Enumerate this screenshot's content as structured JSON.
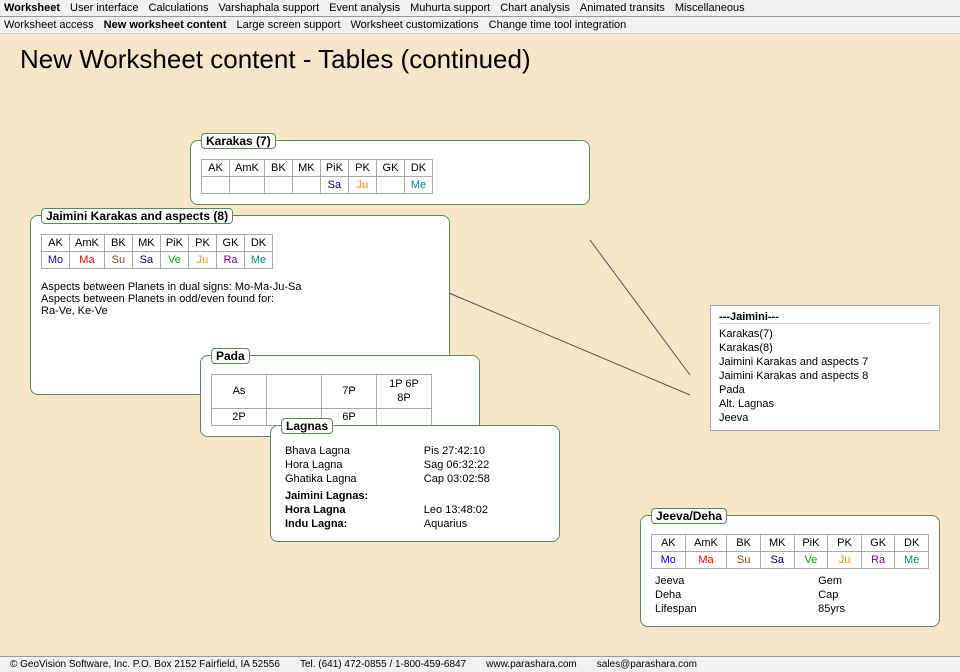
{
  "nav": {
    "items": [
      {
        "label": "Worksheet",
        "bold": true
      },
      {
        "label": "User interface"
      },
      {
        "label": "Calculations"
      },
      {
        "label": "Varshaphala support"
      },
      {
        "label": "Event analysis"
      },
      {
        "label": "Muhurta support"
      },
      {
        "label": "Chart analysis"
      },
      {
        "label": "Animated transits"
      },
      {
        "label": "Miscellaneous"
      }
    ]
  },
  "nav2": {
    "items": [
      {
        "label": "Worksheet access"
      },
      {
        "label": "New worksheet content",
        "bold": true
      },
      {
        "label": "Large screen support"
      },
      {
        "label": "Worksheet customizations"
      },
      {
        "label": "Change time tool integration"
      }
    ]
  },
  "page_title": "New Worksheet content - Tables (continued)",
  "karakas7": {
    "title": "Karakas (7)",
    "headers": [
      "AK",
      "AmK",
      "BK",
      "MK",
      "PiK",
      "PK",
      "GK",
      "DK"
    ],
    "values": [
      "",
      "",
      "",
      "",
      "Sa",
      "Ju",
      "",
      "Me"
    ],
    "colors": [
      "",
      "",
      "",
      "",
      "sa",
      "ju",
      "",
      "me"
    ]
  },
  "jaimini_karakas8": {
    "title": "Jaimini Karakas and aspects (8)",
    "headers": [
      "AK",
      "AmK",
      "BK",
      "MK",
      "PiK",
      "PK",
      "GK",
      "DK"
    ],
    "values": [
      "Mo",
      "Ma",
      "Su",
      "Sa",
      "Ve",
      "Ju",
      "Ra",
      "Me"
    ],
    "colors": [
      "mo",
      "ma",
      "su",
      "sa",
      "ve",
      "ju",
      "ra",
      "me"
    ],
    "aspects_text1": "Aspects between Planets in dual signs: Mo-Ma-Ju-Sa",
    "aspects_text2": "Aspects between Planets in odd/even found for:",
    "aspects_text3": "Ra-Ve, Ke-Ve"
  },
  "pada": {
    "title": "Pada",
    "rows": [
      {
        "col1": "As",
        "col2": "",
        "col3": "7P",
        "col4": "1P 6P\n8P"
      },
      {
        "col1": "2P",
        "col2": "",
        "col3": "6P",
        "col4": ""
      }
    ]
  },
  "lagnas": {
    "title": "Lagnas",
    "items": [
      {
        "name": "Bhava Lagna",
        "value": "Pis 27:42:10"
      },
      {
        "name": "Hora Lagna",
        "value": "Sag 06:32:22"
      },
      {
        "name": "Ghatika Lagna",
        "value": "Cap 03:02:58"
      }
    ],
    "jaimini_title": "Jaimini Lagnas:",
    "jaimini_items": [
      {
        "name": "Hora Lagna",
        "value": "Leo 13:48:02"
      },
      {
        "name": "Indu Lagna:",
        "value": "Aquarius"
      }
    ]
  },
  "sidebar": {
    "items": [
      "---Jaimini---",
      "Karakas(7)",
      "Karakas(8)",
      "Jaimini Karakas and aspects 7",
      "Jaimini Karakas and aspects 8",
      "Pada",
      "Alt. Lagnas",
      "Jeeva"
    ]
  },
  "jeeva_deha": {
    "title": "Jeeva/Deha",
    "headers": [
      "AK",
      "AmK",
      "BK",
      "MK",
      "PiK",
      "PK",
      "GK",
      "DK"
    ],
    "values": [
      "Mo",
      "Ma",
      "Su",
      "Sa",
      "Ve",
      "Ju",
      "Ra",
      "Me"
    ],
    "colors": [
      "mo",
      "ma",
      "su",
      "sa",
      "ve",
      "ju",
      "ra",
      "me"
    ],
    "extra": [
      {
        "label": "Jeeva",
        "value": "Gem"
      },
      {
        "label": "Deha",
        "value": "Cap"
      },
      {
        "label": "Lifespan",
        "value": "85yrs"
      }
    ]
  },
  "footer": {
    "copyright": "© GeoVision Software, Inc. P.O. Box 2152 Fairfield, IA 52556",
    "tel": "Tel. (641) 472-0855 / 1-800-459-6847",
    "website": "www.parashara.com",
    "email": "sales@parashara.com"
  }
}
